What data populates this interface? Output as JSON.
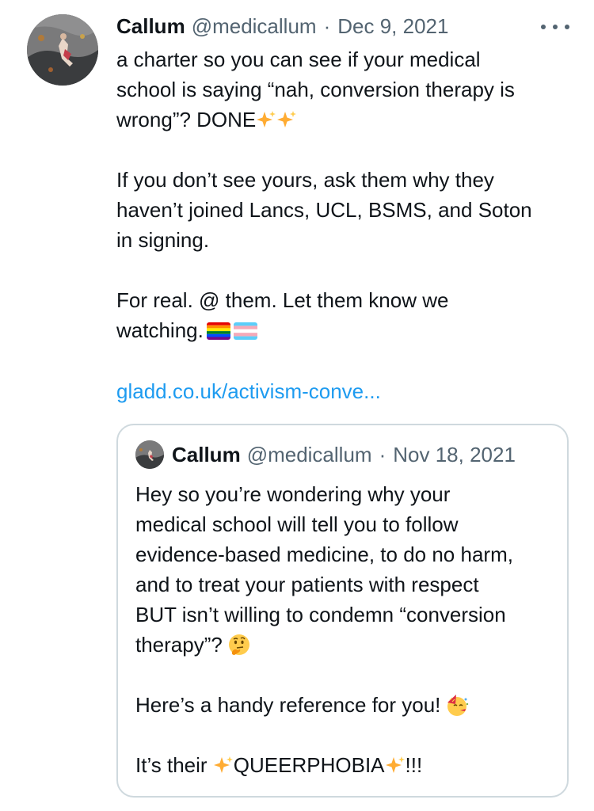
{
  "tweet": {
    "author_name": "Callum",
    "author_handle": "@medicallum",
    "separator": "·",
    "date": "Dec 9, 2021",
    "paragraph1": {
      "line1": "a charter so you can see if your medical",
      "line2": "school is saying “nah, conversion therapy is",
      "line3": "wrong”? DONE"
    },
    "paragraph2": {
      "line1": "If you don’t see yours, ask them why they",
      "line2": "haven’t joined Lancs, UCL, BSMS, and Soton",
      "line3": "in signing."
    },
    "paragraph3": {
      "line1": "For real. @ them. Let them know we",
      "line2": "watching."
    },
    "link": "gladd.co.uk/activism-conve...",
    "more_icon": "more-horizontal-icon"
  },
  "quoted_tweet": {
    "author_name": "Callum",
    "author_handle": "@medicallum",
    "separator": "·",
    "date": "Nov 18, 2021",
    "paragraph1": {
      "line1": "Hey so you’re wondering why your",
      "line2": "medical school will tell you to follow",
      "line3": "evidence-based medicine, to do no harm,",
      "line4": "and to treat your patients with respect",
      "line5": "BUT isn’t willing to condemn “conversion",
      "line6": "therapy”?"
    },
    "paragraph2": "Here’s a handy reference for you!",
    "paragraph3": {
      "before": "It’s their",
      "word": "QUEERPHOBIA",
      "after": "!!!"
    }
  },
  "colors": {
    "text": "#0f1419",
    "secondary": "#536471",
    "link": "#1d9bf0",
    "border": "#cfd9de"
  }
}
